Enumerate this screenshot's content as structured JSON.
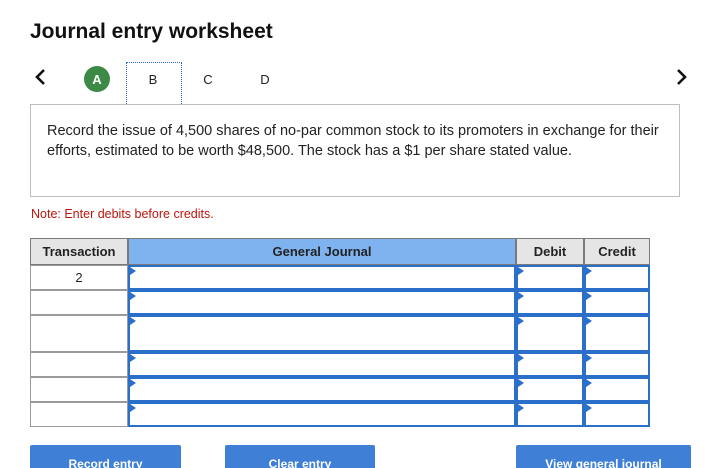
{
  "worksheet": {
    "title": "Journal entry worksheet",
    "nav": {
      "prev_icon": "chevron-left-icon",
      "next_icon": "chevron-right-icon"
    },
    "steps": [
      {
        "label": "A",
        "state": "completed"
      },
      {
        "label": "B",
        "state": "current"
      },
      {
        "label": "C",
        "state": "pending"
      },
      {
        "label": "D",
        "state": "pending"
      }
    ],
    "prompt": "Record the issue of 4,500 shares of no-par common stock to its promoters in exchange for their efforts, estimated to be worth $48,500. The stock has a $1 per share stated value.",
    "note": "Note: Enter debits before credits.",
    "table": {
      "headers": {
        "transaction": "Transaction",
        "general_journal": "General Journal",
        "debit": "Debit",
        "credit": "Credit"
      },
      "rows": [
        {
          "transaction": "2",
          "general_journal": "",
          "debit": "",
          "credit": ""
        },
        {
          "transaction": "",
          "general_journal": "",
          "debit": "",
          "credit": ""
        },
        {
          "transaction": "",
          "general_journal": "",
          "debit": "",
          "credit": ""
        },
        {
          "transaction": "",
          "general_journal": "",
          "debit": "",
          "credit": ""
        },
        {
          "transaction": "",
          "general_journal": "",
          "debit": "",
          "credit": ""
        },
        {
          "transaction": "",
          "general_journal": "",
          "debit": "",
          "credit": ""
        }
      ]
    },
    "buttons": {
      "record": "Record entry",
      "clear": "Clear entry",
      "view": "View general journal"
    },
    "colors": {
      "accent": "#3f7fd6",
      "completed": "#3c8a46",
      "note": "#c0140c",
      "header_highlight": "#7fb3ef"
    }
  }
}
